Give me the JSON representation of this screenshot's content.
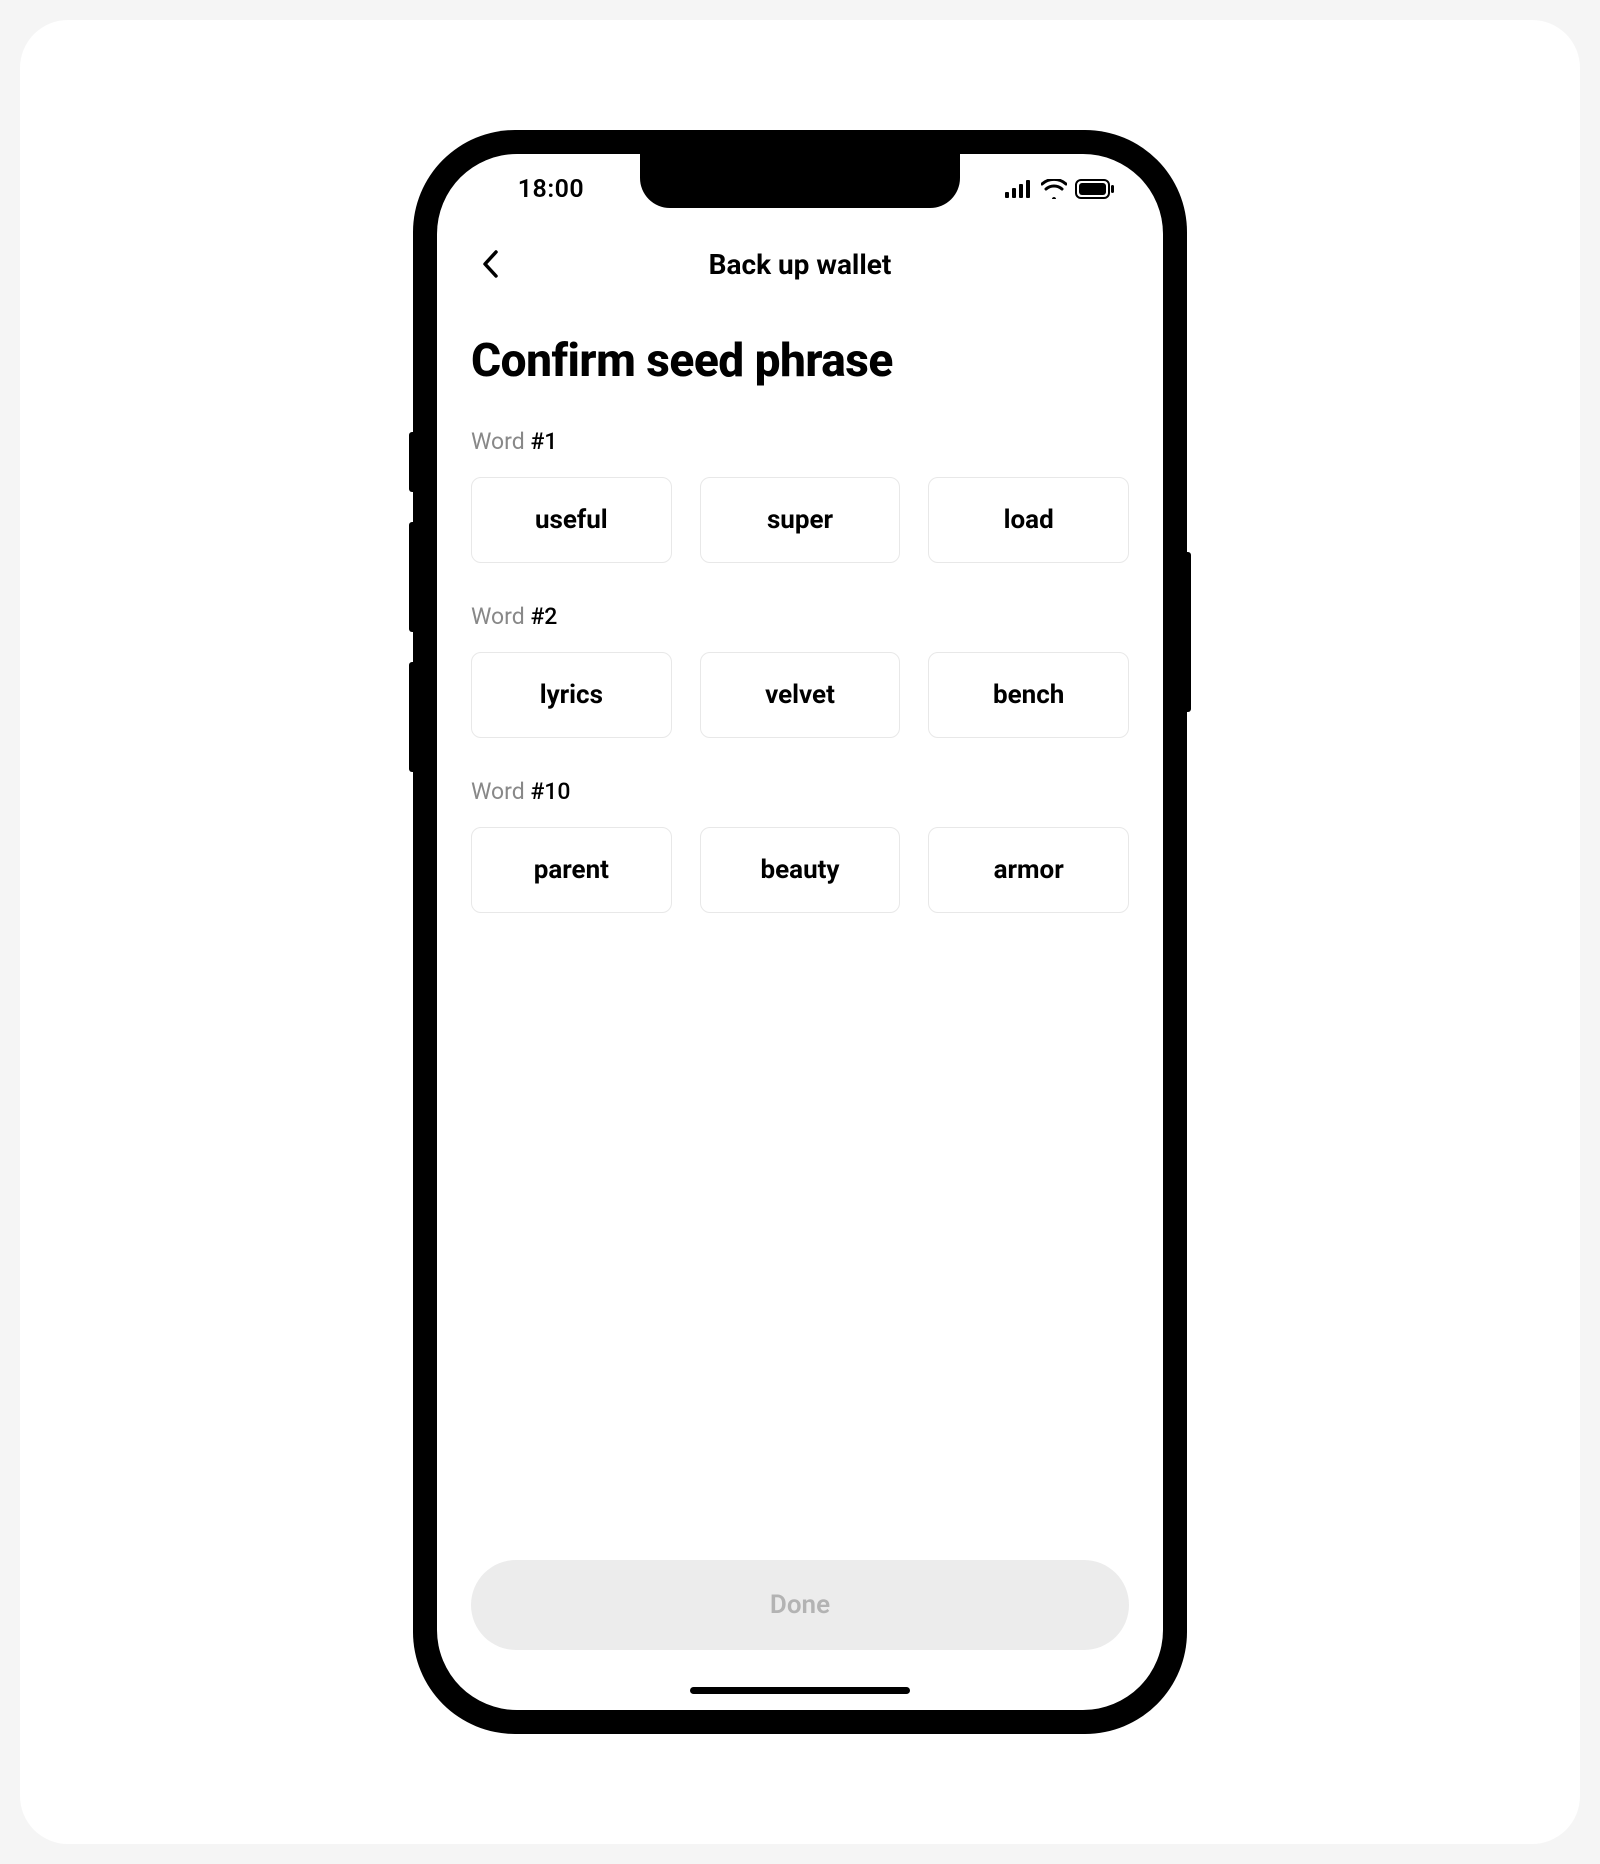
{
  "status": {
    "time": "18:00"
  },
  "nav": {
    "title": "Back up wallet"
  },
  "page": {
    "title": "Confirm seed phrase"
  },
  "groups": [
    {
      "label_prefix": "Word ",
      "label_number": "#1",
      "options": [
        "useful",
        "super",
        "load"
      ]
    },
    {
      "label_prefix": "Word ",
      "label_number": "#2",
      "options": [
        "lyrics",
        "velvet",
        "bench"
      ]
    },
    {
      "label_prefix": "Word ",
      "label_number": "#10",
      "options": [
        "parent",
        "beauty",
        "armor"
      ]
    }
  ],
  "footer": {
    "done_label": "Done"
  }
}
